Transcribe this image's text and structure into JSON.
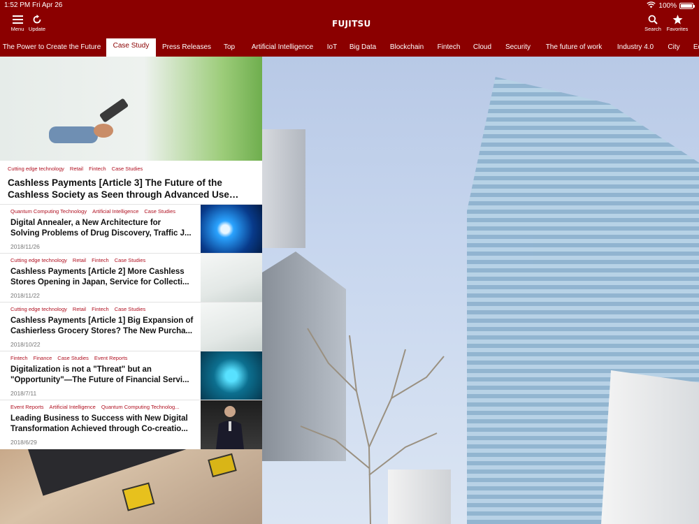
{
  "status_bar": {
    "time": "1:52 PM",
    "date": "Fri Apr 26",
    "battery": "100%",
    "battery_level": 1.0
  },
  "header": {
    "menu_label": "Menu",
    "update_label": "Update",
    "logo_text": "FUJITSU",
    "search_label": "Search",
    "favorites_label": "Favorites"
  },
  "tabs": [
    {
      "label": "The Power to Create the Future",
      "active": false
    },
    {
      "label": "Case Study",
      "active": true
    },
    {
      "label": "Press Releases",
      "active": false
    },
    {
      "label": "Top",
      "active": false
    },
    {
      "label": "Artificial Intelligence",
      "active": false
    },
    {
      "label": "IoT",
      "active": false
    },
    {
      "label": "Big Data",
      "active": false
    },
    {
      "label": "Blockchain",
      "active": false
    },
    {
      "label": "Fintech",
      "active": false
    },
    {
      "label": "Cloud",
      "active": false
    },
    {
      "label": "Security",
      "active": false
    },
    {
      "label": "The future of work",
      "active": false
    },
    {
      "label": "Industry 4.0",
      "active": false
    },
    {
      "label": "City",
      "active": false
    },
    {
      "label": "Ed",
      "active": false
    }
  ],
  "featured": {
    "categories": [
      "Cutting edge technology",
      "Retail",
      "Fintech",
      "Case Studies"
    ],
    "title": "Cashless Payments [Article 3] The Future of the Cashless Society as Seen through Advanced Use Case..."
  },
  "articles": [
    {
      "categories": [
        "Quantum Computing Technology",
        "Artificial Intelligence",
        "Case Studies"
      ],
      "title_line1": "Digital Annealer, a New Architecture for",
      "title_line2": "Solving Problems of Drug Discovery, Traffic J...",
      "date": "2018/11/26"
    },
    {
      "categories": [
        "Cutting edge technology",
        "Retail",
        "Fintech",
        "Case Studies"
      ],
      "title_line1": "Cashless Payments [Article 2] More Cashless",
      "title_line2": "Stores Opening in Japan, Service for Collecti...",
      "date": "2018/11/22"
    },
    {
      "categories": [
        "Cutting edge technology",
        "Retail",
        "Fintech",
        "Case Studies"
      ],
      "title_line1": "Cashless Payments [Article 1] Big Expansion of",
      "title_line2": "Cashierless Grocery Stores? The New Purcha...",
      "date": "2018/10/22"
    },
    {
      "categories": [
        "Fintech",
        "Finance",
        "Case Studies",
        "Event Reports"
      ],
      "title_line1": "Digitalization is not a \"Threat\" but an",
      "title_line2": "\"Opportunity\"—The Future of Financial Servi...",
      "date": "2018/7/11"
    },
    {
      "categories": [
        "Event Reports",
        "Artificial Intelligence",
        "Quantum Computing Technolog..."
      ],
      "title_line1": "Leading Business to Success with New Digital",
      "title_line2": "Transformation Achieved through Co-creatio...",
      "date": "2018/6/29"
    }
  ],
  "colors": {
    "brand": "#8b0000",
    "category": "#b01020"
  },
  "icons": [
    "hamburger-icon",
    "refresh-icon",
    "search-icon",
    "star-icon",
    "wifi-icon",
    "battery-icon"
  ]
}
